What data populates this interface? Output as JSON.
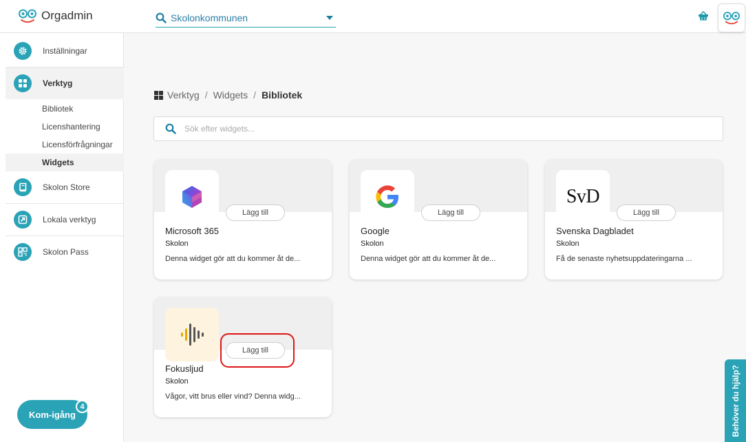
{
  "app": {
    "title": "Orgadmin"
  },
  "org_selector": {
    "value": "Skolonkommunen"
  },
  "sidebar": {
    "items": [
      {
        "label": "Inställningar",
        "icon": "gear-icon"
      },
      {
        "label": "Verktyg",
        "icon": "grid-icon"
      },
      {
        "label": "Skolon Store",
        "icon": "book-icon"
      },
      {
        "label": "Lokala verktyg",
        "icon": "external-link-icon"
      },
      {
        "label": "Skolon Pass",
        "icon": "qr-code-icon"
      }
    ],
    "sub_items": [
      "Bibliotek",
      "Licenshantering",
      "Licensförfrågningar",
      "Widgets"
    ]
  },
  "breadcrumb": {
    "items": [
      "Verktyg",
      "Widgets",
      "Bibliotek"
    ],
    "separator": "/"
  },
  "search": {
    "placeholder": "Sök efter widgets..."
  },
  "widgets": [
    {
      "title": "Microsoft 365",
      "publisher": "Skolon",
      "description": "Denna widget gör att du kommer åt de...",
      "add_label": "Lägg till",
      "icon": "microsoft-365-icon"
    },
    {
      "title": "Google",
      "publisher": "Skolon",
      "description": "Denna widget gör att du kommer åt de...",
      "add_label": "Lägg till",
      "icon": "google-icon"
    },
    {
      "title": "Svenska Dagbladet",
      "publisher": "Skolon",
      "description": "Få de senaste nyhetsuppdateringarna ...",
      "add_label": "Lägg till",
      "icon": "svd-logo",
      "logo_text": "SvD"
    },
    {
      "title": "Fokusljud",
      "publisher": "Skolon",
      "description": "Vågor, vitt brus eller vind? Denna widg...",
      "add_label": "Lägg till",
      "icon": "soundwave-icon"
    }
  ],
  "get_started": {
    "label": "Kom-igång",
    "badge": "4"
  },
  "help_tab": {
    "label": "Behöver du hjälp?"
  },
  "colors": {
    "accent": "#2aa3b7",
    "highlight": "#e01414",
    "link": "#2a7fa8"
  }
}
